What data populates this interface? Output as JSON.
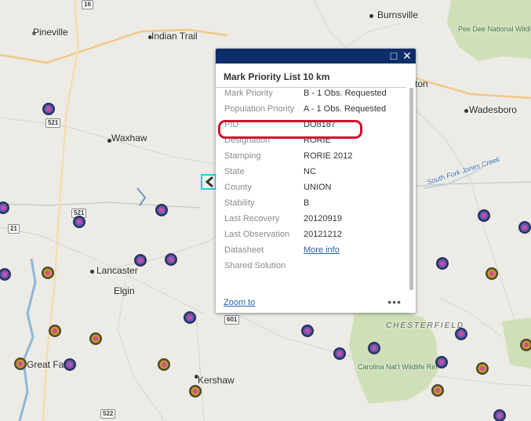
{
  "map": {
    "places": [
      {
        "id": "pineville",
        "label": "Pineville",
        "big": true
      },
      {
        "id": "indian-trail",
        "label": "Indian Trail",
        "big": true
      },
      {
        "id": "burnsville",
        "label": "Burnsville",
        "big": true
      },
      {
        "id": "waxhaw",
        "label": "Waxhaw",
        "big": true
      },
      {
        "id": "wadesboro",
        "label": "Wadesboro",
        "big": true
      },
      {
        "id": "lancaster",
        "label": "Lancaster",
        "big": true
      },
      {
        "id": "elgin",
        "label": "Elgin",
        "big": true
      },
      {
        "id": "great-falls",
        "label": "Great Falls",
        "big": true
      },
      {
        "id": "kershaw",
        "label": "Kershaw",
        "big": true
      },
      {
        "id": "chesterfield",
        "label": "CHESTERFIELD"
      },
      {
        "id": "pee-dee",
        "label": "Pee Dee National Wildlife Refuge"
      },
      {
        "id": "carolina-natl",
        "label": "Carolina Nat'l Wildlife Ref"
      },
      {
        "id": "south-fork",
        "label": "South Fork Jones Creek"
      },
      {
        "id": "ton-partial",
        "label": "ton"
      }
    ],
    "shields": [
      "16",
      "521",
      "521",
      "21",
      "522",
      "601"
    ]
  },
  "popup": {
    "title": "Mark Priority List 10 km",
    "fields": [
      {
        "key": "Mark Priority",
        "value": "B - 1 Obs. Requested"
      },
      {
        "key": "Population Priority",
        "value": "A - 1 Obs. Requested"
      },
      {
        "key": "PID",
        "value": "DO8187"
      },
      {
        "key": "Designation",
        "value": "RORIE"
      },
      {
        "key": "Stamping",
        "value": "RORIE 2012"
      },
      {
        "key": "State",
        "value": "NC"
      },
      {
        "key": "County",
        "value": "UNION"
      },
      {
        "key": "Stability",
        "value": "B"
      },
      {
        "key": "Last Recovery",
        "value": "20120919"
      },
      {
        "key": "Last Observation",
        "value": "20121212"
      },
      {
        "key": "Datasheet",
        "value": "More info"
      },
      {
        "key": "Shared Solution",
        "value": ""
      }
    ],
    "zoom_to": "Zoom to",
    "more": "•••",
    "maximize_icon": "□",
    "close_icon": "✕"
  },
  "colors": {
    "popup_header": "#0d2d6b",
    "highlight": "#d0112b",
    "selection": "#27c8e0",
    "link": "#2a62b0",
    "marker_blue": "#5b5fb5",
    "marker_gold": "#c89b2a"
  }
}
